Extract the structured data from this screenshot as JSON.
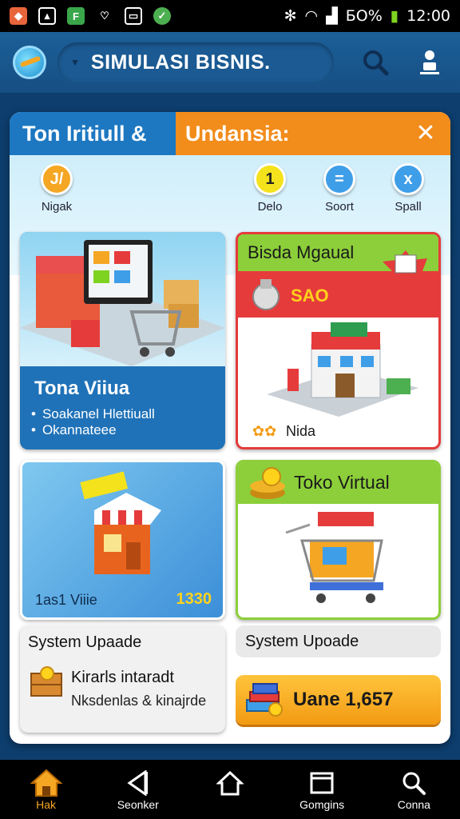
{
  "status_bar": {
    "battery": "БО%",
    "time": "12:00"
  },
  "app_bar": {
    "title": "SIMULASI BISNIS."
  },
  "panel": {
    "header_left": "Ton Iritiull &",
    "header_right": "Undansia:"
  },
  "tools": [
    {
      "label": "Nigak",
      "glyph": "J/",
      "color": "#f5a623"
    },
    {
      "label": "Delo",
      "glyph": "1",
      "color": "#f4e21c"
    },
    {
      "label": "Soort",
      "glyph": "=",
      "color": "#3f9ee8"
    },
    {
      "label": "Spall",
      "glyph": "x",
      "color": "#3f9ee8"
    }
  ],
  "cards": {
    "store_card": {
      "title": "Tona Viiua",
      "bullets": [
        "Soakanel Hlettiuall",
        "Okannateee"
      ]
    },
    "sale_card": {
      "title": "Bisda Mgaual",
      "sale": "SAO",
      "price": "Nida"
    },
    "shop_card": {
      "left": "1as1 Viiie",
      "right": "1330"
    },
    "virtual_card": {
      "title": "Toko Virtual"
    },
    "upgrade_left": {
      "title": "System Upaade",
      "line1": "Kirarls intaradt",
      "line2": "Nksdenlas & kinajrde"
    },
    "upgrade_right": {
      "title": "System Upoade"
    }
  },
  "buy_button": {
    "label": "Uane 1,657"
  },
  "bottom_nav": [
    {
      "label": "Hak",
      "icon": "home-icon"
    },
    {
      "label": "Seonker",
      "icon": "back-icon"
    },
    {
      "label": "",
      "icon": "home-outline-icon"
    },
    {
      "label": "Gomgins",
      "icon": "recents-icon"
    },
    {
      "label": "Conna",
      "icon": "search-icon"
    }
  ]
}
